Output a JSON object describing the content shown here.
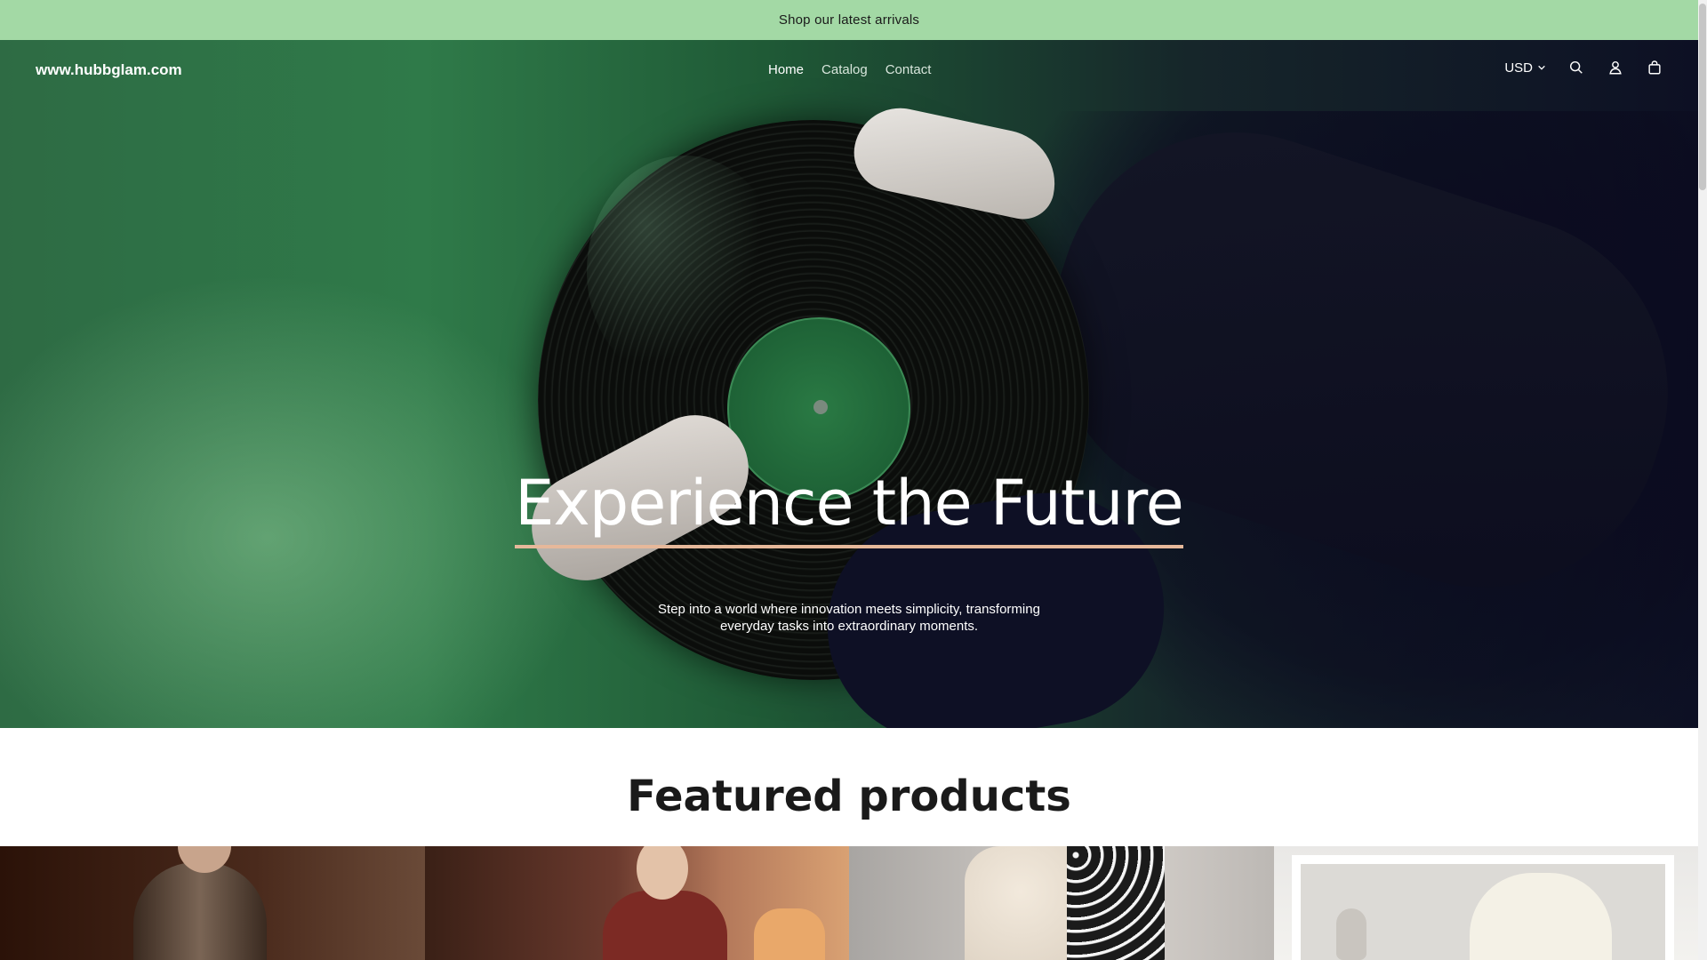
{
  "announcement": {
    "text": "Shop our latest arrivals"
  },
  "header": {
    "logo": "www.hubbglam.com",
    "nav": [
      {
        "label": "Home",
        "active": true
      },
      {
        "label": "Catalog",
        "active": false
      },
      {
        "label": "Contact",
        "active": false
      }
    ],
    "currency": "USD",
    "icons": [
      "chevron-down-icon",
      "search-icon",
      "account-icon",
      "cart-icon"
    ]
  },
  "hero": {
    "title": "Experience the Future",
    "subtitle": "Step into a world where innovation meets simplicity, transforming everyday tasks into extraordinary moments."
  },
  "featured": {
    "title": "Featured products"
  },
  "colors": {
    "announcement_bg": "#a3d9a5",
    "hero_green": "#2f7a49",
    "title_underline": "#e6b89a"
  }
}
